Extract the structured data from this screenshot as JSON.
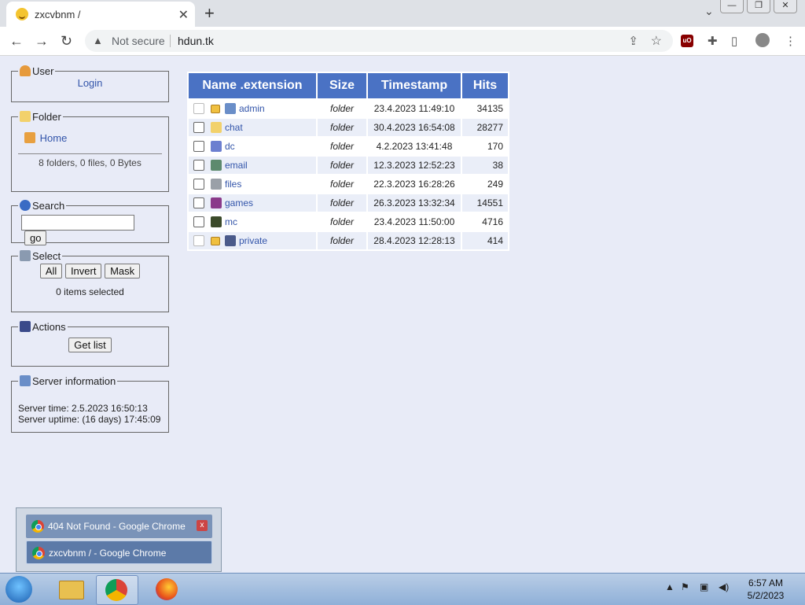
{
  "browser": {
    "tab_title": "zxcvbnm /",
    "tab_close": "✕",
    "new_tab": "+",
    "not_secure": "Not secure",
    "url": "hdun.tk",
    "ublock_label": "uO"
  },
  "sidebar": {
    "user": {
      "legend": "User",
      "login": "Login"
    },
    "folder": {
      "legend": "Folder",
      "home": "Home",
      "summary": "8 folders, 0 files, 0 Bytes"
    },
    "search": {
      "legend": "Search",
      "value": "",
      "go": "go"
    },
    "select": {
      "legend": "Select",
      "all": "All",
      "invert": "Invert",
      "mask": "Mask",
      "status": "0 items selected"
    },
    "actions": {
      "legend": "Actions",
      "get_list": "Get list"
    },
    "server": {
      "legend": "Server information",
      "time": "Server time: 2.5.2023 16:50:13",
      "uptime": "Server uptime: (16 days) 17:45:09"
    }
  },
  "table": {
    "headers": {
      "name": "Name .extension",
      "size": "Size",
      "timestamp": "Timestamp",
      "hits": "Hits"
    },
    "rows": [
      {
        "name": "admin",
        "size": "folder",
        "timestamp": "23.4.2023 11:49:10",
        "hits": "34135",
        "locked": true,
        "icon": "computer-folder-icon",
        "color": "#6a8ec8"
      },
      {
        "name": "chat",
        "size": "folder",
        "timestamp": "30.4.2023 16:54:08",
        "hits": "28277",
        "locked": false,
        "icon": "folder-icon",
        "color": "#f2d16b"
      },
      {
        "name": "dc",
        "size": "folder",
        "timestamp": "4.2.2023 13:41:48",
        "hits": "170",
        "locked": false,
        "icon": "disc-icon",
        "color": "#6c7fd0"
      },
      {
        "name": "email",
        "size": "folder",
        "timestamp": "12.3.2023 12:52:23",
        "hits": "38",
        "locked": false,
        "icon": "email-icon",
        "color": "#5d8a6e"
      },
      {
        "name": "files",
        "size": "folder",
        "timestamp": "22.3.2023 16:28:26",
        "hits": "249",
        "locked": false,
        "icon": "drive-icon",
        "color": "#9aa0a8"
      },
      {
        "name": "games",
        "size": "folder",
        "timestamp": "26.3.2023 13:32:34",
        "hits": "14551",
        "locked": false,
        "icon": "games-icon",
        "color": "#8a3a8a"
      },
      {
        "name": "mc",
        "size": "folder",
        "timestamp": "23.4.2023 11:50:00",
        "hits": "4716",
        "locked": false,
        "icon": "minecraft-icon",
        "color": "#3b4a2a"
      },
      {
        "name": "private",
        "size": "folder",
        "timestamp": "28.4.2023 12:28:13",
        "hits": "414",
        "locked": true,
        "icon": "save-icon",
        "color": "#4a5a8a"
      }
    ]
  },
  "taskbar_popup": {
    "items": [
      {
        "title": "404 Not Found - Google Chrome"
      },
      {
        "title": "zxcvbnm / - Google Chrome"
      }
    ],
    "close": "x"
  },
  "taskbar": {
    "time": "6:57 AM",
    "date": "5/2/2023"
  }
}
